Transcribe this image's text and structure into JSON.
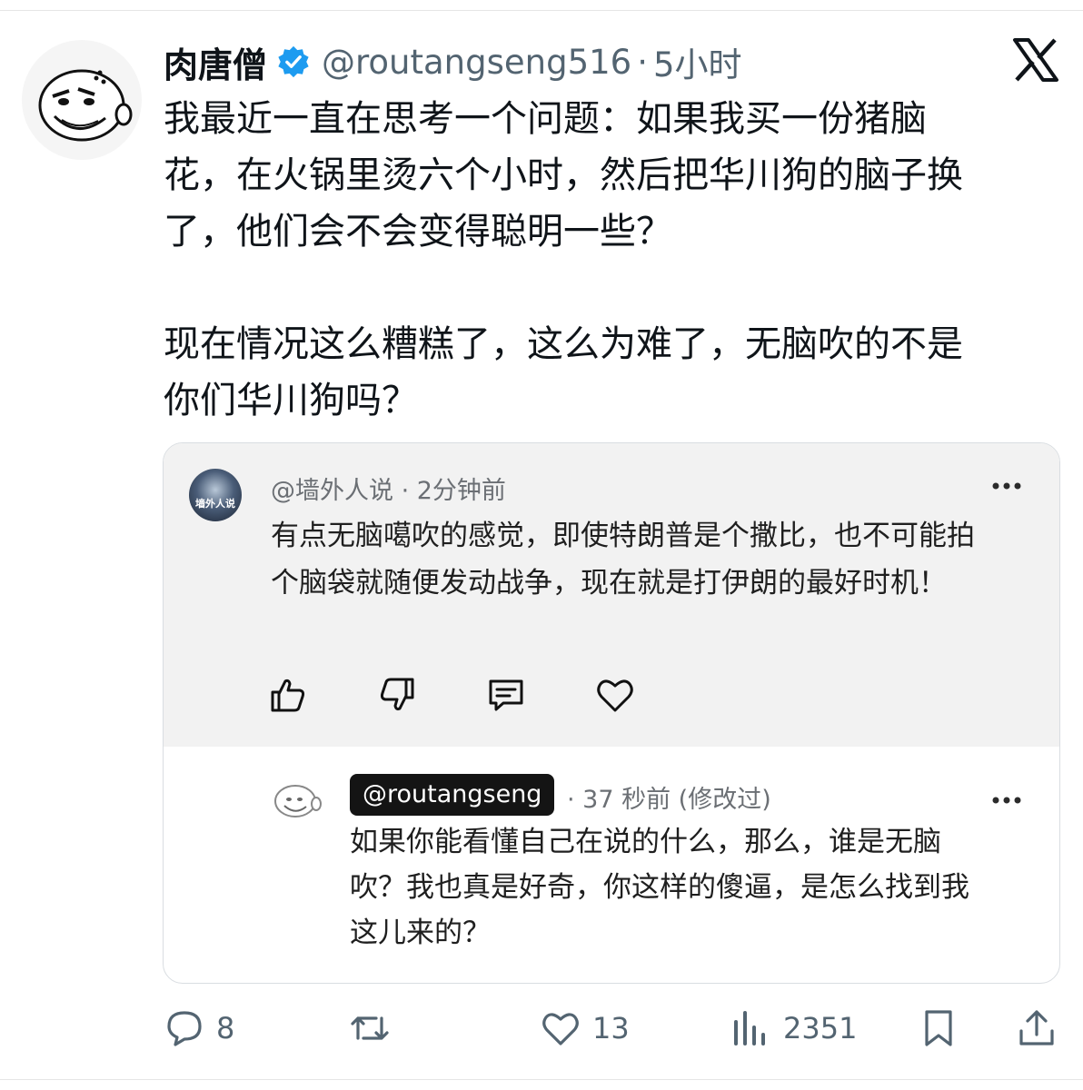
{
  "tweet": {
    "display_name": "肉唐僧",
    "handle": "@routangseng516",
    "separator": "·",
    "time": "5小时",
    "text": "我最近一直在思考一个问题：如果我买一份猪脑\n花，在火锅里烫六个小时，然后把华川狗的脑子换\n了，他们会不会变得聪明一些？\n\n现在情况这么糟糕了，这么为难了，无脑吹的不是\n你们华川狗吗？",
    "verified_icon": "verified-badge-icon",
    "brand_icon": "x-logo-icon"
  },
  "quote": {
    "avatar_label": "墙外人说",
    "meta": "@墙外人说 · 2分钟前",
    "text": "有点无脑噶吹的感觉，即使特朗普是个撒比，也不可能拍个脑袋就随便发动战争，现在就是打伊朗的最好时机！",
    "actions": [
      "thumbs-up-icon",
      "thumbs-down-icon",
      "comment-icon",
      "heart-icon"
    ]
  },
  "reply": {
    "handle": "@routangseng",
    "meta": "· 37 秒前 (修改过)",
    "text": "如果你能看懂自己在说的什么，那么，谁是无脑吹？我也真是好奇，你这样的傻逼，是怎么找到我这儿来的？"
  },
  "actions": {
    "replies": "8",
    "likes": "13",
    "views": "2351"
  },
  "colors": {
    "verified_blue": "#1d9bf0",
    "secondary_text": "#536471",
    "quote_background": "#f2f2f2"
  }
}
